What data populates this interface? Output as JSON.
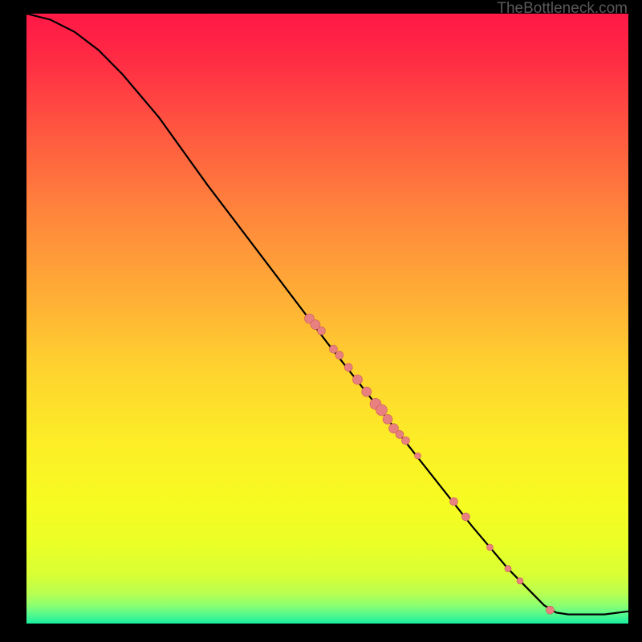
{
  "watermark": "TheBottleneck.com",
  "chart_data": {
    "type": "line",
    "title": "",
    "xlabel": "",
    "ylabel": "",
    "xlim": [
      0,
      100
    ],
    "ylim": [
      0,
      100
    ],
    "curve": [
      {
        "x": 0,
        "y": 100
      },
      {
        "x": 4,
        "y": 99
      },
      {
        "x": 8,
        "y": 97
      },
      {
        "x": 12,
        "y": 94
      },
      {
        "x": 16,
        "y": 90
      },
      {
        "x": 22,
        "y": 83
      },
      {
        "x": 30,
        "y": 72
      },
      {
        "x": 40,
        "y": 59
      },
      {
        "x": 50,
        "y": 46
      },
      {
        "x": 58,
        "y": 36
      },
      {
        "x": 66,
        "y": 26
      },
      {
        "x": 74,
        "y": 16
      },
      {
        "x": 80,
        "y": 9
      },
      {
        "x": 86,
        "y": 3
      },
      {
        "x": 88,
        "y": 1.8
      },
      {
        "x": 90,
        "y": 1.5
      },
      {
        "x": 96,
        "y": 1.5
      },
      {
        "x": 100,
        "y": 2
      }
    ],
    "points": [
      {
        "x": 47,
        "y": 50,
        "r": 6
      },
      {
        "x": 48,
        "y": 49,
        "r": 6
      },
      {
        "x": 49,
        "y": 48,
        "r": 5
      },
      {
        "x": 51,
        "y": 45,
        "r": 5
      },
      {
        "x": 52,
        "y": 44,
        "r": 5
      },
      {
        "x": 53.5,
        "y": 42,
        "r": 5
      },
      {
        "x": 55,
        "y": 40,
        "r": 6
      },
      {
        "x": 56.5,
        "y": 38,
        "r": 6
      },
      {
        "x": 58,
        "y": 36,
        "r": 7
      },
      {
        "x": 59,
        "y": 35,
        "r": 7
      },
      {
        "x": 60,
        "y": 33.5,
        "r": 6
      },
      {
        "x": 61,
        "y": 32,
        "r": 6
      },
      {
        "x": 62,
        "y": 31,
        "r": 5
      },
      {
        "x": 63,
        "y": 30,
        "r": 5
      },
      {
        "x": 65,
        "y": 27.5,
        "r": 4
      },
      {
        "x": 71,
        "y": 20,
        "r": 5
      },
      {
        "x": 73,
        "y": 17.5,
        "r": 5
      },
      {
        "x": 77,
        "y": 12.5,
        "r": 4
      },
      {
        "x": 80,
        "y": 9,
        "r": 4
      },
      {
        "x": 82,
        "y": 7,
        "r": 4
      },
      {
        "x": 87,
        "y": 2.2,
        "r": 5
      }
    ],
    "colors": {
      "curve": "#000000",
      "point_fill": "#e98080",
      "point_stroke": "#c85a5a"
    }
  }
}
